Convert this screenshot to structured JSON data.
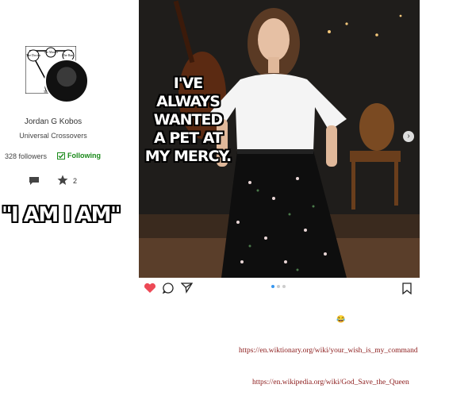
{
  "profile": {
    "logo_labels": [
      "The Doctor",
      "The Master",
      "The Rani",
      "The Doctor"
    ],
    "name": "Jordan G Kobos",
    "subtitle": "Universal Crossovers",
    "followers": "328 followers",
    "following_label": "Following",
    "star_count": "2"
  },
  "meme_left": "\"I AM I AM\"",
  "post": {
    "meme_lines": [
      "I'VE",
      "ALWAYS",
      "WANTED",
      "A PET AT",
      "MY MERCY."
    ],
    "carousel_dots": 3,
    "active_dot": 0
  },
  "footer": {
    "emoji": "😂",
    "link1": "https://en.wiktionary.org/wiki/your_wish_is_my_command",
    "link2": "https://en.wikipedia.org/wiki/God_Save_the_Queen"
  },
  "colors": {
    "following": "#1a8a1a",
    "heart": "#ed4956",
    "link": "#8b1a1a",
    "active_dot": "#3797f0"
  },
  "icons": [
    "chat-icon",
    "star-icon",
    "heart-icon",
    "comment-icon",
    "share-icon",
    "bookmark-icon",
    "chevron-right-icon",
    "check-box-icon"
  ]
}
